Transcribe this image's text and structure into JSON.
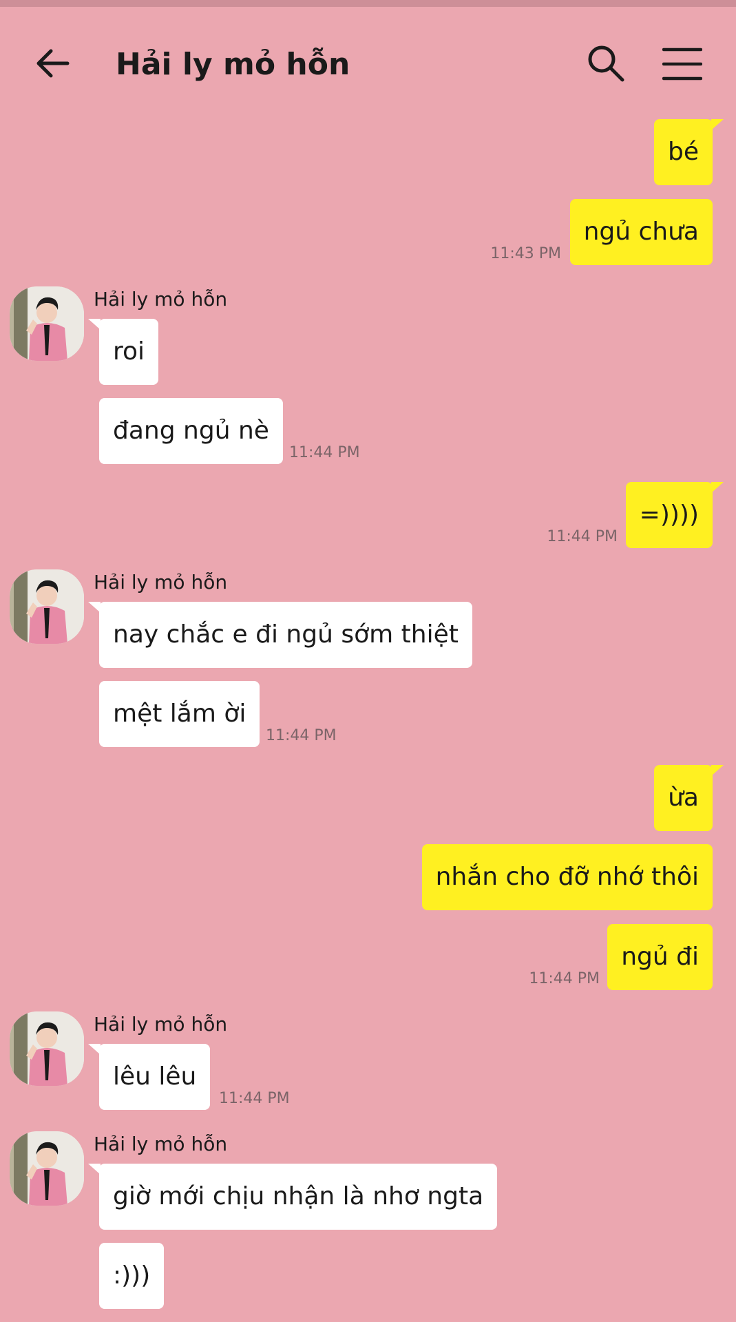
{
  "header": {
    "title": "Hải ly mỏ hỗn"
  },
  "colors": {
    "background": "#eba7b0",
    "sent_bubble": "#fff021",
    "received_bubble": "#ffffff",
    "timestamp": "#7b6468"
  },
  "messages": [
    {
      "text": "bé"
    },
    {
      "text": "ngủ chưa",
      "time": "11:43 PM"
    },
    {
      "sender": "Hải ly mỏ hỗn",
      "text": "roi"
    },
    {
      "text": "đang ngủ nè",
      "time": "11:44 PM"
    },
    {
      "text": "=))))",
      "time": "11:44 PM"
    },
    {
      "sender": "Hải ly mỏ hỗn",
      "text": "nay chắc e đi ngủ sớm thiệt"
    },
    {
      "text": "mệt lắm ời",
      "time": "11:44 PM"
    },
    {
      "text": "ừa"
    },
    {
      "text": "nhắn cho đỡ nhớ thôi"
    },
    {
      "text": "ngủ đi",
      "time": "11:44 PM"
    },
    {
      "sender": "Hải ly mỏ hỗn",
      "text": "lêu lêu",
      "time": "11:44 PM"
    },
    {
      "sender": "Hải ly mỏ hỗn",
      "text": "giờ mới chịu nhận là nhơ ngta"
    },
    {
      "text": ":)))"
    }
  ]
}
